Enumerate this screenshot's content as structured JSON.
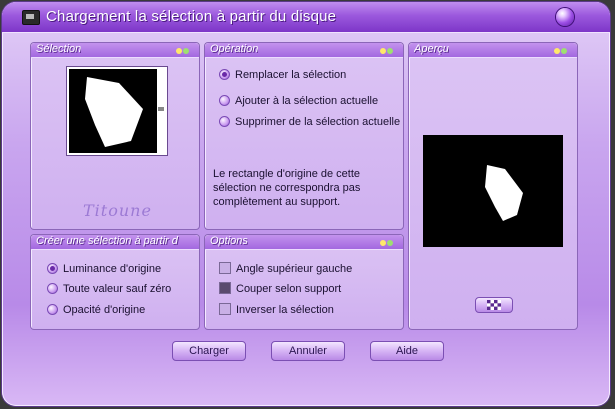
{
  "window": {
    "title": "Chargement la sélection à partir du disque"
  },
  "panels": {
    "selection": {
      "title": "Sélection",
      "watermark": "Titoune"
    },
    "operation": {
      "title": "Opération",
      "options": [
        {
          "label": "Remplacer la sélection",
          "selected": true
        },
        {
          "label": "Ajouter à la sélection actuelle",
          "selected": false
        },
        {
          "label": "Supprimer de la sélection actuelle",
          "selected": false
        }
      ],
      "note": "Le rectangle d'origine de cette sélection ne correspondra pas complètement au support."
    },
    "apercu": {
      "title": "Aperçu"
    },
    "creer": {
      "title": "Créer une sélection à partir d",
      "options": [
        {
          "label": "Luminance d'origine",
          "selected": true
        },
        {
          "label": "Toute valeur sauf zéro",
          "selected": false
        },
        {
          "label": "Opacité d'origine",
          "selected": false
        }
      ]
    },
    "options": {
      "title": "Options",
      "checkboxes": [
        {
          "label": "Angle supérieur gauche",
          "checked": false
        },
        {
          "label": "Couper selon support",
          "checked": true
        },
        {
          "label": "Inverser la sélection",
          "checked": false
        }
      ]
    }
  },
  "buttons": {
    "load": "Charger",
    "cancel": "Annuler",
    "help": "Aide"
  },
  "colors": {
    "accent": "#9b58dd",
    "panel_bg": "#d6bcf2",
    "preview_bg": "#000000"
  }
}
